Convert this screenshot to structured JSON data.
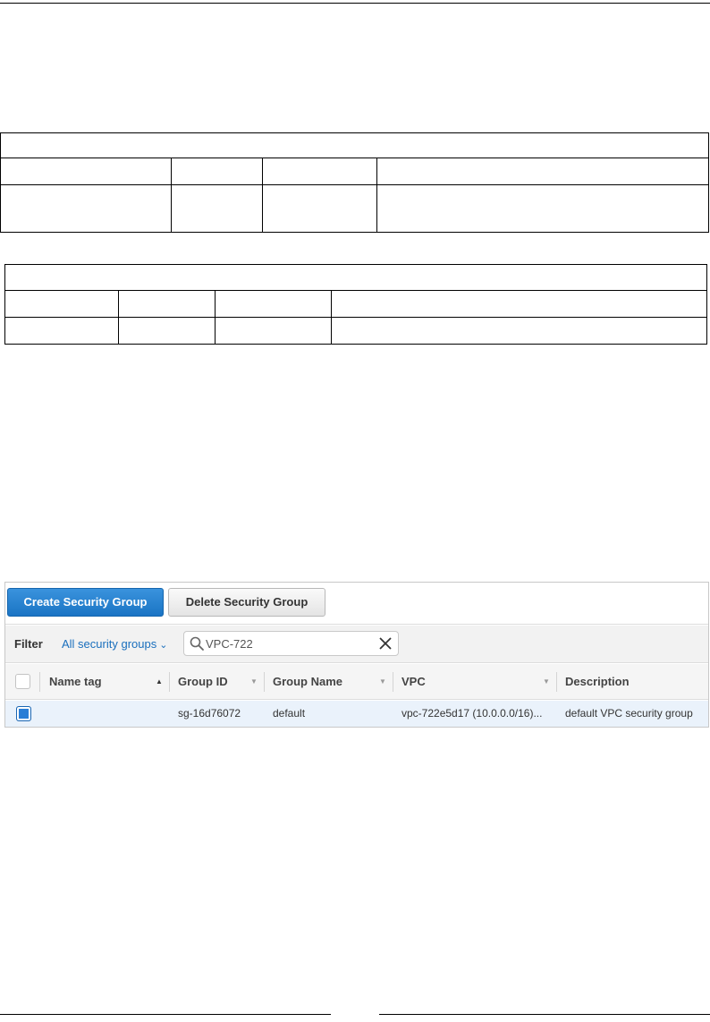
{
  "toolbar": {
    "create_label": "Create Security Group",
    "delete_label": "Delete Security Group"
  },
  "filter": {
    "label": "Filter",
    "dropdown_value": "All security groups",
    "search_value": "VPC-722"
  },
  "columns": {
    "name_tag": "Name tag",
    "group_id": "Group ID",
    "group_name": "Group Name",
    "vpc": "VPC",
    "description": "Description"
  },
  "rows": [
    {
      "name_tag": "",
      "group_id": "sg-16d76072",
      "group_name": "default",
      "vpc": "vpc-722e5d17 (10.0.0.0/16)...",
      "description": "default VPC security group",
      "selected": true
    }
  ],
  "icons": {
    "search": "search-icon",
    "clear": "close-icon",
    "dropdown": "chevron-down-icon",
    "sort_asc": "sort-ascending-icon",
    "sort": "sort-icon"
  },
  "colors": {
    "primary": "#1a74c4",
    "link": "#1a6fbd",
    "selected_row": "#eaf2fb"
  }
}
